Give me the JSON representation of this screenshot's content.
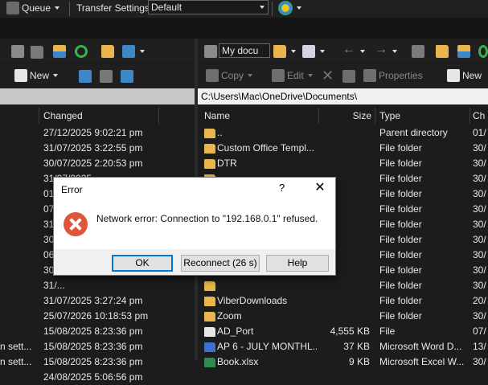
{
  "top_toolbar": {
    "queue_label": "Queue",
    "transfer_settings_label": "Transfer Settings",
    "transfer_settings_value": "Default"
  },
  "left_toolbar": {
    "new_label": "New"
  },
  "right_toolbar": {
    "folder_combo_value": "My docu",
    "copy_label": "Copy",
    "edit_label": "Edit",
    "properties_label": "Properties",
    "new_label": "New"
  },
  "left_panel": {
    "columns": {
      "changed": "Changed"
    },
    "rows": [
      {
        "name": "",
        "changed": "27/12/2025 9:02:21 pm"
      },
      {
        "name": "",
        "changed": "31/07/2025 3:22:55 pm"
      },
      {
        "name": "",
        "changed": "30/07/2025 2:20:53 pm"
      },
      {
        "name": "",
        "changed": "31/07/2025 ..."
      },
      {
        "name": "",
        "changed": "01/..."
      },
      {
        "name": "",
        "changed": "07/..."
      },
      {
        "name": "",
        "changed": "31/..."
      },
      {
        "name": "",
        "changed": "30/..."
      },
      {
        "name": "",
        "changed": "06/..."
      },
      {
        "name": "",
        "changed": "30/..."
      },
      {
        "name": "",
        "changed": "31/..."
      },
      {
        "name": "",
        "changed": "31/07/2025 3:27:24 pm"
      },
      {
        "name": "",
        "changed": "25/07/2026 10:18:53 pm"
      },
      {
        "name": "",
        "changed": "15/08/2025 8:23:36 pm"
      },
      {
        "name": "n sett...",
        "changed": "15/08/2025 8:23:36 pm"
      },
      {
        "name": "n sett...",
        "changed": "15/08/2025 8:23:36 pm"
      },
      {
        "name": "",
        "changed": "24/08/2025 5:06:56 pm"
      }
    ]
  },
  "right_panel": {
    "path": "C:\\Users\\Mac\\OneDrive\\Documents\\",
    "columns": {
      "name": "Name",
      "size": "Size",
      "type": "Type",
      "changed": "Ch"
    },
    "rows": [
      {
        "icon": "up-folder-icon",
        "name": "..",
        "size": "",
        "type": "Parent directory",
        "changed": "01/"
      },
      {
        "icon": "folder-icon",
        "name": "Custom Office Templ...",
        "size": "",
        "type": "File folder",
        "changed": "30/"
      },
      {
        "icon": "folder-icon",
        "name": "DTR",
        "size": "",
        "type": "File folder",
        "changed": "30/"
      },
      {
        "icon": "folder-icon",
        "name": "",
        "size": "",
        "type": "File folder",
        "changed": "30/"
      },
      {
        "icon": "folder-icon",
        "name": "",
        "size": "",
        "type": "File folder",
        "changed": "30/"
      },
      {
        "icon": "folder-icon",
        "name": "",
        "size": "",
        "type": "File folder",
        "changed": "30/"
      },
      {
        "icon": "folder-icon",
        "name": "",
        "size": "",
        "type": "File folder",
        "changed": "30/"
      },
      {
        "icon": "folder-icon",
        "name": "",
        "size": "",
        "type": "File folder",
        "changed": "30/"
      },
      {
        "icon": "folder-icon",
        "name": "",
        "size": "",
        "type": "File folder",
        "changed": "30/"
      },
      {
        "icon": "folder-icon",
        "name": "",
        "size": "",
        "type": "File folder",
        "changed": "30/"
      },
      {
        "icon": "folder-icon",
        "name": "",
        "size": "",
        "type": "File folder",
        "changed": "30/"
      },
      {
        "icon": "folder-icon",
        "name": "ViberDownloads",
        "size": "",
        "type": "File folder",
        "changed": "20/"
      },
      {
        "icon": "folder-icon",
        "name": "Zoom",
        "size": "",
        "type": "File folder",
        "changed": "30/"
      },
      {
        "icon": "file-icon",
        "name": "AD_Port",
        "size": "4,555 KB",
        "type": "File",
        "changed": "07/"
      },
      {
        "icon": "word-doc-icon",
        "name": "AP 6 - JULY MONTHL...",
        "size": "37 KB",
        "type": "Microsoft Word D...",
        "changed": "13/"
      },
      {
        "icon": "excel-doc-icon",
        "name": "Book.xlsx",
        "size": "9 KB",
        "type": "Microsoft Excel W...",
        "changed": "30/"
      }
    ]
  },
  "dialog": {
    "title": "Error",
    "help_glyph": "?",
    "close_glyph": "✕",
    "message": "Network error: Connection to \"192.168.0.1\" refused.",
    "ok_label": "OK",
    "reconnect_label": "Reconnect (26 s)",
    "help_label": "Help"
  },
  "colors": {
    "background": "#1c1c1c",
    "path_bar_background": "#f0f0f0",
    "folder": "#e8b64a",
    "error_icon": "#e0543a",
    "default_button_border": "#0078d7"
  }
}
